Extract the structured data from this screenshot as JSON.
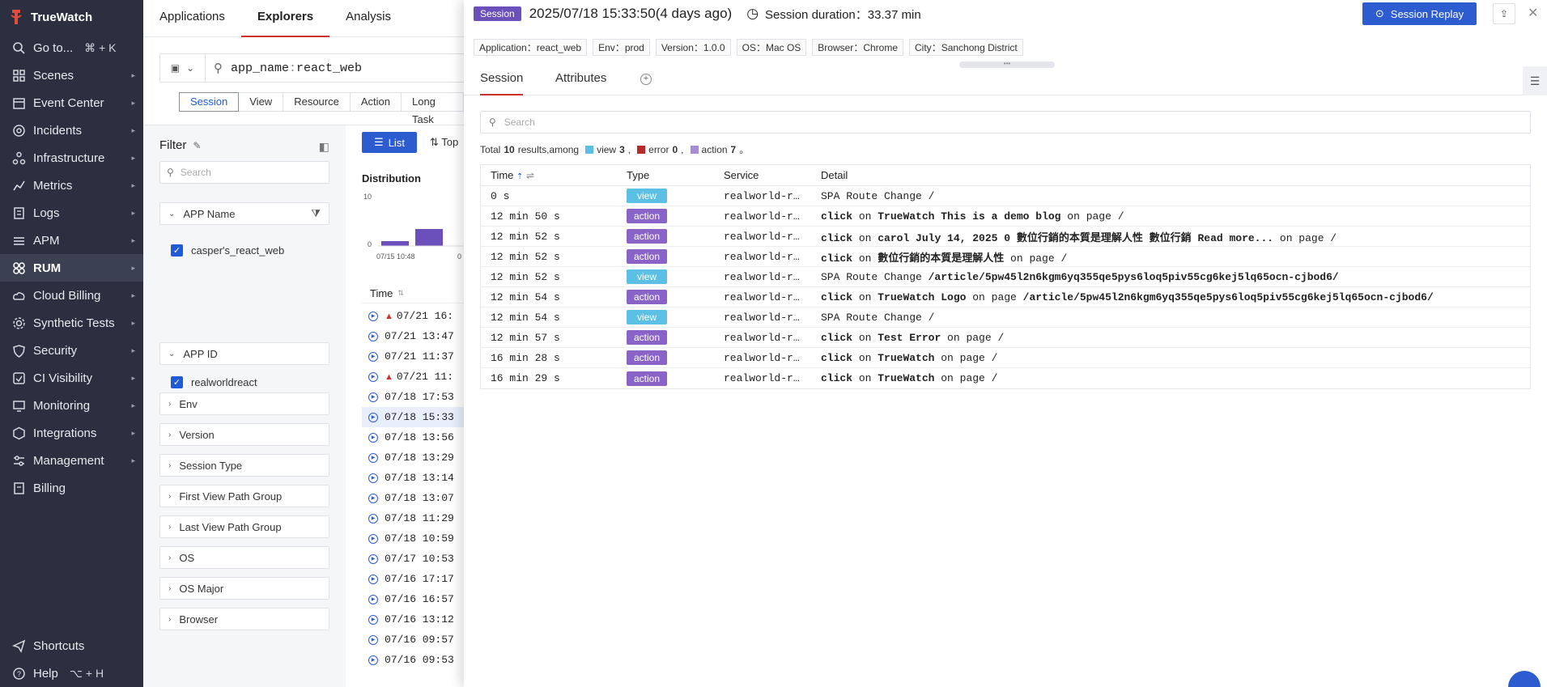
{
  "brand": {
    "name": "TrueWatch"
  },
  "sidebar": {
    "items": [
      {
        "label": "Go to...",
        "shortcut": "⌘ + K",
        "icon": "search-icon",
        "arrow": false
      },
      {
        "label": "Scenes",
        "icon": "grid-icon",
        "arrow": true
      },
      {
        "label": "Event Center",
        "icon": "calendar-icon",
        "arrow": true
      },
      {
        "label": "Incidents",
        "icon": "bell-circle-icon",
        "arrow": true
      },
      {
        "label": "Infrastructure",
        "icon": "nodes-icon",
        "arrow": true
      },
      {
        "label": "Metrics",
        "icon": "line-chart-icon",
        "arrow": true
      },
      {
        "label": "Logs",
        "icon": "log-icon",
        "arrow": true
      },
      {
        "label": "APM",
        "icon": "apm-icon",
        "arrow": true
      },
      {
        "label": "RUM",
        "icon": "rum-icon",
        "arrow": true,
        "active": true
      },
      {
        "label": "Cloud Billing",
        "icon": "cloud-icon",
        "arrow": true
      },
      {
        "label": "Synthetic Tests",
        "icon": "gear-icon",
        "arrow": true
      },
      {
        "label": "Security",
        "icon": "shield-icon",
        "arrow": true
      },
      {
        "label": "CI Visibility",
        "icon": "ci-icon",
        "arrow": true
      },
      {
        "label": "Monitoring",
        "icon": "monitor-icon",
        "arrow": true
      },
      {
        "label": "Integrations",
        "icon": "hex-icon",
        "arrow": true
      },
      {
        "label": "Management",
        "icon": "sliders-icon",
        "arrow": true
      },
      {
        "label": "Billing",
        "icon": "billing-icon",
        "arrow": false
      }
    ],
    "bottom": [
      {
        "label": "Shortcuts",
        "icon": "send-icon"
      },
      {
        "label": "Help",
        "shortcut": "⌥ + H",
        "icon": "help-icon"
      }
    ]
  },
  "topnav": {
    "tabs": [
      "Applications",
      "Explorers",
      "Analysis Dashboard"
    ]
  },
  "explorer": {
    "query_key": "app_name",
    "query_sep": ":",
    "query_value": "react_web",
    "subtabs": [
      "Session",
      "View",
      "Resource",
      "Action",
      "Long Task"
    ],
    "filter": {
      "title": "Filter",
      "search_placeholder": "Search",
      "groups": [
        "APP Name",
        "APP ID",
        "Env",
        "Version",
        "Session Type",
        "First View Path Group",
        "Last View Path Group",
        "OS",
        "OS Major",
        "Browser"
      ],
      "app_name_value": "casper's_react_web",
      "app_id_value": "realworldreact"
    },
    "list_label": "List",
    "top_label": "Top",
    "distribution_title": "Distribution",
    "dist_y_ticks": [
      "10",
      "0"
    ],
    "dist_x_ticks": [
      "07/15 10:48",
      "0"
    ],
    "time_col": "Time",
    "rows": [
      {
        "t": "07/21 16:",
        "warn": true
      },
      {
        "t": "07/21 13:47",
        "warn": false
      },
      {
        "t": "07/21 11:37",
        "warn": false
      },
      {
        "t": "07/21 11:",
        "warn": true
      },
      {
        "t": "07/18 17:53",
        "warn": false
      },
      {
        "t": "07/18 15:33",
        "warn": false,
        "selected": true
      },
      {
        "t": "07/18 13:56",
        "warn": false
      },
      {
        "t": "07/18 13:29",
        "warn": false
      },
      {
        "t": "07/18 13:14",
        "warn": false
      },
      {
        "t": "07/18 13:07",
        "warn": false
      },
      {
        "t": "07/18 11:29",
        "warn": false
      },
      {
        "t": "07/18 10:59",
        "warn": false
      },
      {
        "t": "07/17 10:53",
        "warn": false
      },
      {
        "t": "07/16 17:17",
        "warn": false
      },
      {
        "t": "07/16 16:57",
        "warn": false
      },
      {
        "t": "07/16 13:12",
        "warn": false
      },
      {
        "t": "07/16 09:57",
        "warn": false
      },
      {
        "t": "07/16 09:53",
        "warn": false
      }
    ]
  },
  "drawer": {
    "badge": "Session",
    "datetime": "2025/07/18 15:33:50",
    "ago": "(4 days ago)",
    "duration_label": "Session duration",
    "duration_sep": "：",
    "duration_value": "33.37 min",
    "replay_label": "Session Replay",
    "tags": [
      {
        "k": "Application",
        "v": "react_web"
      },
      {
        "k": "Env",
        "v": "prod"
      },
      {
        "k": "Version",
        "v": "1.0.0"
      },
      {
        "k": "OS",
        "v": "Mac OS"
      },
      {
        "k": "Browser",
        "v": "Chrome"
      },
      {
        "k": "City",
        "v": "Sanchong District"
      }
    ],
    "tabs": [
      "Session",
      "Attributes"
    ],
    "search_placeholder": "Search",
    "summary": {
      "total_label": "Total",
      "total": "10",
      "results_label": "results,among",
      "view_label": "view",
      "view_count": "3",
      "error_label": "error",
      "error_count": "0",
      "action_label": "action",
      "action_count": "7",
      "colors": {
        "view": "#5bc0e3",
        "error": "#b52b27",
        "action": "#a68bd6"
      }
    },
    "table_headers": [
      "Time",
      "Type",
      "Service",
      "Detail"
    ],
    "events": [
      {
        "time": "0 s",
        "type": "view",
        "service": "realworld-r…",
        "detail": [
          {
            "t": "SPA Route Change /",
            "b": false
          }
        ]
      },
      {
        "time": "12 min 50 s",
        "type": "action",
        "service": "realworld-r…",
        "detail": [
          {
            "t": "click",
            "b": true
          },
          {
            "t": " on ",
            "b": false
          },
          {
            "t": "TrueWatch This is a demo blog",
            "b": true
          },
          {
            "t": " on page /",
            "b": false
          }
        ]
      },
      {
        "time": "12 min 52 s",
        "type": "action",
        "service": "realworld-r…",
        "detail": [
          {
            "t": "click",
            "b": true
          },
          {
            "t": " on ",
            "b": false
          },
          {
            "t": "carol July 14, 2025 0 數位行銷的本質是理解人性 數位行銷 Read more...",
            "b": true
          },
          {
            "t": " on page /",
            "b": false
          }
        ]
      },
      {
        "time": "12 min 52 s",
        "type": "action",
        "service": "realworld-r…",
        "detail": [
          {
            "t": "click",
            "b": true
          },
          {
            "t": " on ",
            "b": false
          },
          {
            "t": "數位行銷的本質是理解人性",
            "b": true
          },
          {
            "t": " on page /",
            "b": false
          }
        ]
      },
      {
        "time": "12 min 52 s",
        "type": "view",
        "service": "realworld-r…",
        "detail": [
          {
            "t": "SPA Route Change ",
            "b": false
          },
          {
            "t": "/article/5pw45l2n6kgm6yq355qe5pys6loq5piv55cg6kej5lq65ocn-cjbod6/",
            "b": true
          }
        ]
      },
      {
        "time": "12 min 54 s",
        "type": "action",
        "service": "realworld-r…",
        "detail": [
          {
            "t": "click",
            "b": true
          },
          {
            "t": " on ",
            "b": false
          },
          {
            "t": "TrueWatch Logo",
            "b": true
          },
          {
            "t": " on page ",
            "b": false
          },
          {
            "t": "/article/5pw45l2n6kgm6yq355qe5pys6loq5piv55cg6kej5lq65ocn-cjbod6/",
            "b": true
          }
        ]
      },
      {
        "time": "12 min 54 s",
        "type": "view",
        "service": "realworld-r…",
        "detail": [
          {
            "t": "SPA Route Change /",
            "b": false
          }
        ]
      },
      {
        "time": "12 min 57 s",
        "type": "action",
        "service": "realworld-r…",
        "detail": [
          {
            "t": "click",
            "b": true
          },
          {
            "t": " on ",
            "b": false
          },
          {
            "t": "Test Error",
            "b": true
          },
          {
            "t": " on page /",
            "b": false
          }
        ]
      },
      {
        "time": "16 min 28 s",
        "type": "action",
        "service": "realworld-r…",
        "detail": [
          {
            "t": "click",
            "b": true
          },
          {
            "t": " on ",
            "b": false
          },
          {
            "t": "TrueWatch",
            "b": true
          },
          {
            "t": " on page /",
            "b": false
          }
        ]
      },
      {
        "time": "16 min 29 s",
        "type": "action",
        "service": "realworld-r…",
        "detail": [
          {
            "t": "click",
            "b": true
          },
          {
            "t": " on ",
            "b": false
          },
          {
            "t": "TrueWatch",
            "b": true
          },
          {
            "t": " on page /",
            "b": false
          }
        ]
      }
    ]
  }
}
